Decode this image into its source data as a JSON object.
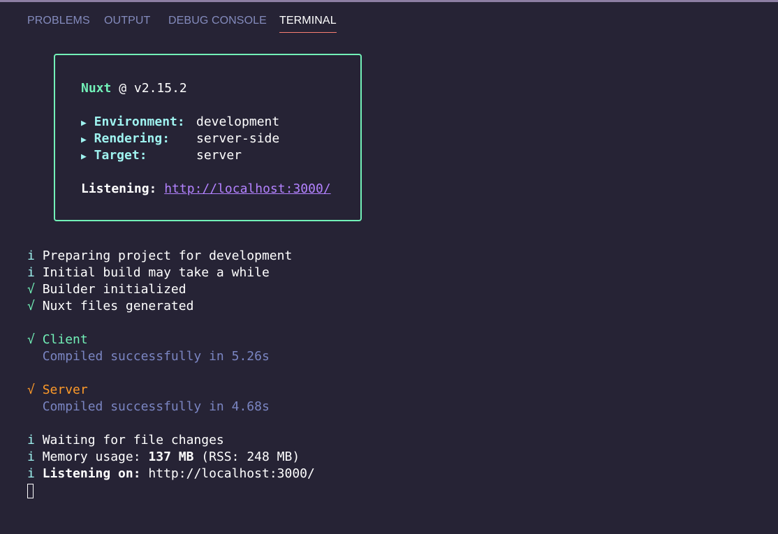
{
  "panel": {
    "tabs": [
      {
        "label": "PROBLEMS"
      },
      {
        "label": "OUTPUT"
      },
      {
        "label": "DEBUG CONSOLE"
      },
      {
        "label": "TERMINAL"
      }
    ],
    "active_tab": "TERMINAL"
  },
  "banner": {
    "name": "Nuxt",
    "at": "@",
    "version": "v2.15.2",
    "bullet_icon": "triangle-right-icon",
    "environment_label": "Environment:",
    "environment_value": "development",
    "rendering_label": "Rendering:",
    "rendering_value": "server-side",
    "target_label": "Target:",
    "target_value": "server",
    "listening_label": "Listening:",
    "listening_url": "http://localhost:3000/"
  },
  "log": {
    "info_symbol": "i",
    "check_symbol": "√",
    "lines": [
      "Preparing project for development",
      "Initial build may take a while",
      "Builder initialized",
      "Nuxt files generated"
    ],
    "client_label": "Client",
    "client_status": "Compiled successfully in 5.26s",
    "server_label": "Server",
    "server_status": "Compiled successfully in 4.68s",
    "waiting": "Waiting for file changes",
    "memory_prefix": "Memory usage:",
    "memory_value": "137 MB",
    "memory_rss": "(RSS: 248 MB)",
    "listening_on_label": "Listening on:",
    "listening_on_url": "http://localhost:3000/"
  },
  "colors": {
    "background": "#262335",
    "nuxt_green": "#72f1b8",
    "info_cyan": "#9ff3f0",
    "server_orange": "#fe9a29",
    "link_purple": "#b382ff",
    "dim_text": "#7a85c2",
    "active_tab_underline": "#f97e72"
  }
}
